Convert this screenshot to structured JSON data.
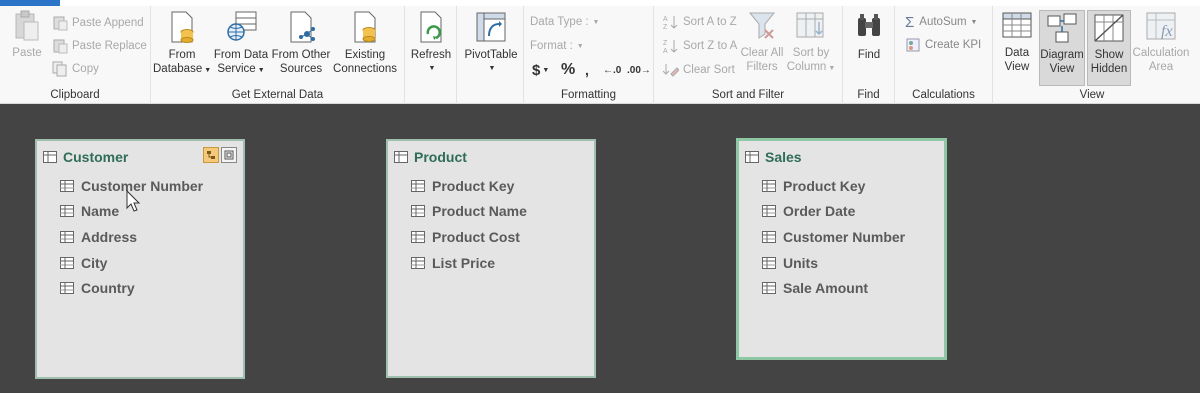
{
  "ribbon": {
    "clipboard": {
      "group_label": "Clipboard",
      "paste": "Paste",
      "paste_append": "Paste Append",
      "paste_replace": "Paste Replace",
      "copy": "Copy"
    },
    "external": {
      "group_label": "Get External Data",
      "from_database": [
        "From",
        "Database"
      ],
      "from_data_service": [
        "From Data",
        "Service"
      ],
      "from_other_sources": [
        "From Other",
        "Sources"
      ],
      "existing_connections": [
        "Existing",
        "Connections"
      ]
    },
    "refresh": {
      "label": "Refresh"
    },
    "pivot": {
      "label": "PivotTable"
    },
    "formatting": {
      "group_label": "Formatting",
      "data_type": "Data Type :",
      "format": "Format :",
      "currency": "$",
      "percent": "%",
      "comma": "ʕ",
      "inc_decimal": ".0→.00",
      "dec_decimal": ".00→.0"
    },
    "sortfilter": {
      "group_label": "Sort and Filter",
      "sort_az": "Sort A to Z",
      "sort_za": "Sort Z to A",
      "clear_sort": "Clear Sort",
      "clear_all_filters": [
        "Clear All",
        "Filters"
      ],
      "sort_by_column": [
        "Sort by",
        "Column"
      ]
    },
    "find": {
      "group_label": "Find",
      "label": "Find"
    },
    "calculations": {
      "group_label": "Calculations",
      "autosum": "AutoSum",
      "create_kpi": "Create KPI"
    },
    "view": {
      "group_label": "View",
      "data_view": [
        "Data",
        "View"
      ],
      "diagram_view": [
        "Diagram",
        "View"
      ],
      "show_hidden": [
        "Show",
        "Hidden"
      ],
      "calculation_area": [
        "Calculation",
        "Area"
      ]
    }
  },
  "tables": [
    {
      "name": "Customer",
      "columns": [
        "Customer Number",
        "Name",
        "Address",
        "City",
        "Country"
      ]
    },
    {
      "name": "Product",
      "columns": [
        "Product Key",
        "Product Name",
        "Product Cost",
        "List Price"
      ]
    },
    {
      "name": "Sales",
      "columns": [
        "Product Key",
        "Order Date",
        "Customer Number",
        "Units",
        "Sale Amount"
      ]
    }
  ],
  "colors": {
    "accent": "#2b74c8",
    "table_title": "#2f6d56",
    "canvas": "#444444"
  }
}
